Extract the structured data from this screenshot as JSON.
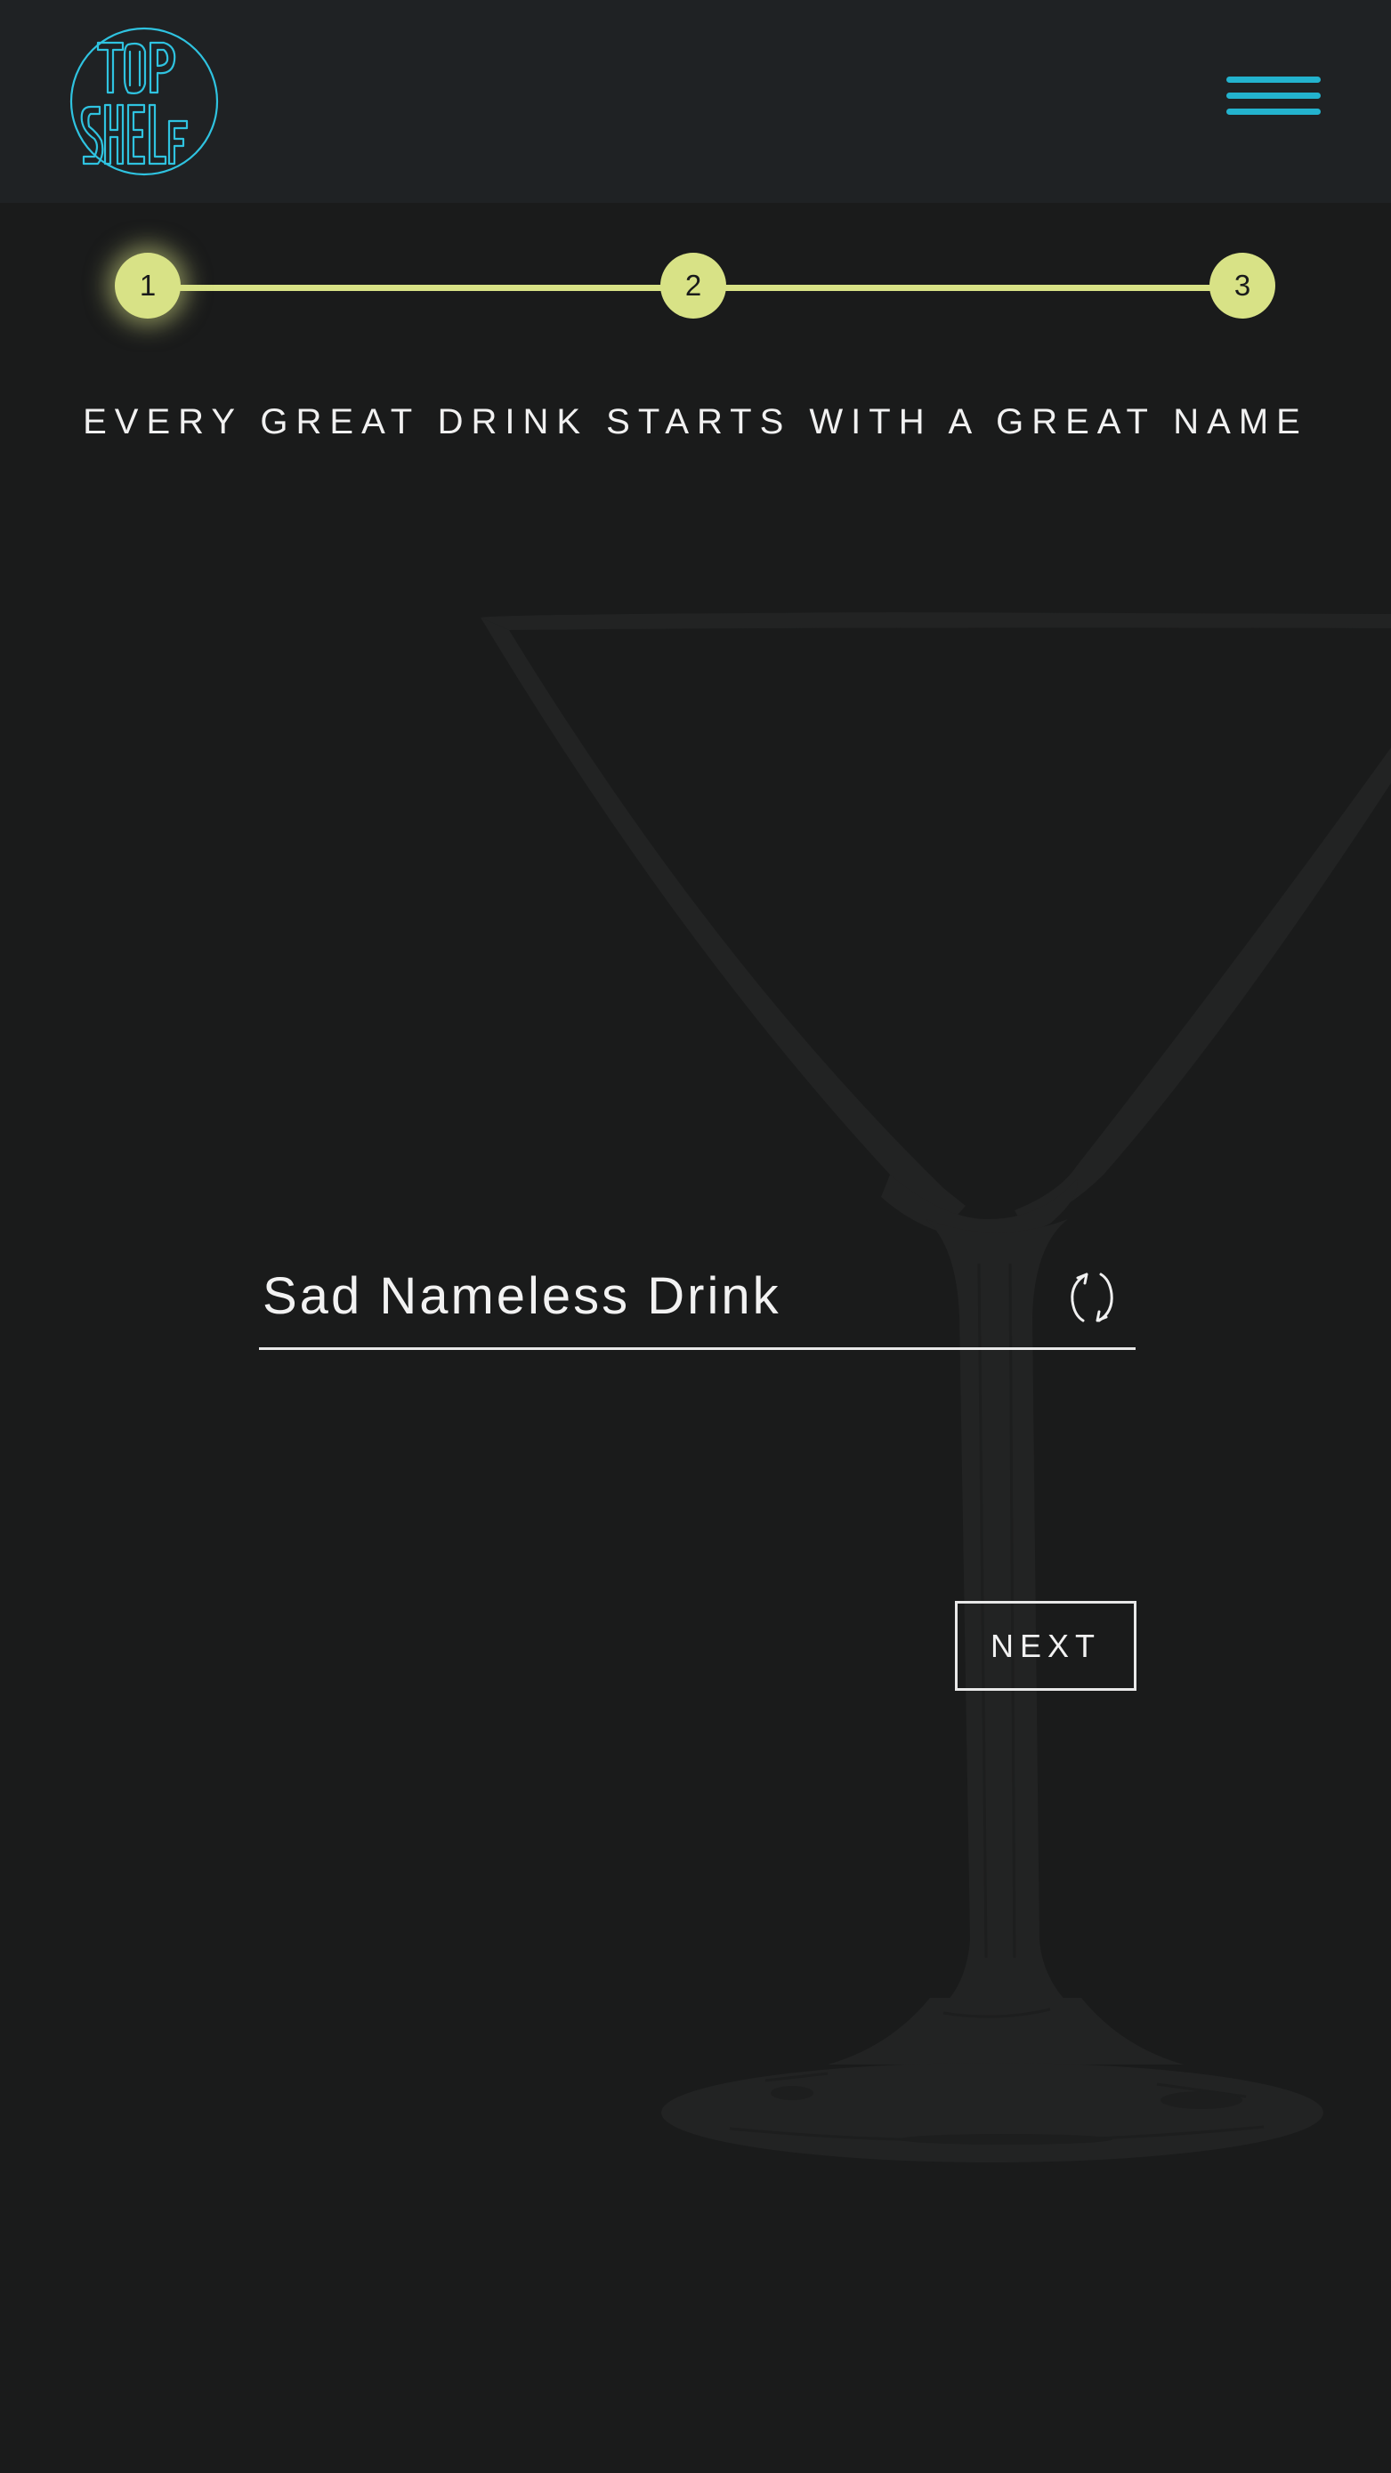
{
  "header": {
    "logo_text": "TOP SHELF",
    "logo_icon": "top-shelf-neon-logo",
    "menu_icon": "hamburger-menu-icon"
  },
  "stepper": {
    "steps": [
      {
        "label": "1",
        "state": "active"
      },
      {
        "label": "2",
        "state": "upcoming"
      },
      {
        "label": "3",
        "state": "upcoming"
      }
    ],
    "current_step": 1
  },
  "main": {
    "tagline": "EVERY GREAT DRINK STARTS WITH A GREAT NAME",
    "drink_name": {
      "value": "Sad Nameless Drink",
      "refresh_icon": "refresh-icon"
    },
    "next_label": "NEXT",
    "background_image": "martini-glass-illustration"
  },
  "colors": {
    "background": "#1a1b1b",
    "header_background": "#1f2224",
    "accent_cyan": "#23b3ce",
    "accent_lime": "#d8e286",
    "text": "#f2f2f2"
  }
}
